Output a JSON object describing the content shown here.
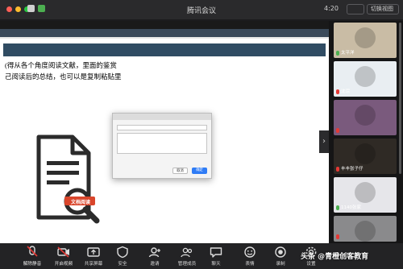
{
  "app": {
    "title": "腾讯会议",
    "time": "4:20",
    "btn_left": "",
    "btn_right": "切换视图"
  },
  "slide": {
    "heading": "(得从各个角度阅读文献，里面的鉴赏",
    "subtitle": "己阅读后的总结，也可以是复制粘贴里",
    "icon_badge": "文档阅读"
  },
  "dialog": {
    "title": "",
    "prompt": "",
    "url": "",
    "cancel": "取消",
    "ok": "确定"
  },
  "doc_lines": [
    "",
    "",
    "",
    "",
    "",
    "",
    "",
    "",
    "",
    "",
    "",
    "",
    "",
    "",
    "",
    "",
    "",
    "",
    "",
    "",
    "",
    "",
    "",
    "",
    "",
    "",
    "",
    "",
    "",
    "",
    "",
    "",
    ""
  ],
  "participants": [
    {
      "name": "太平洋",
      "color": "#c9bca5",
      "muted": false
    },
    {
      "name": "沈淙",
      "color": "#e9eef2",
      "muted": true
    },
    {
      "name": "",
      "color": "#7a5a7d",
      "muted": true
    },
    {
      "name": "丰丰张子仔",
      "color": "#2f2a25",
      "muted": true
    },
    {
      "name": "1140张家",
      "color": "#e6e6ea",
      "muted": false
    },
    {
      "name": "",
      "color": "#8a8a8c",
      "muted": true
    }
  ],
  "toolbar": [
    {
      "label": "解除静音",
      "icon": "mic-muted-icon",
      "red": true
    },
    {
      "label": "开启视频",
      "icon": "video-off-icon",
      "red": true
    },
    {
      "label": "共享屏幕",
      "icon": "share-screen-icon",
      "red": false
    },
    {
      "label": "安全",
      "icon": "shield-icon",
      "red": false
    },
    {
      "label": "邀请",
      "icon": "invite-icon",
      "red": false
    },
    {
      "label": "管理成员",
      "icon": "members-icon",
      "red": false
    },
    {
      "label": "聊天",
      "icon": "chat-icon",
      "red": false
    },
    {
      "label": "表情",
      "icon": "reaction-icon",
      "red": false
    },
    {
      "label": "录制",
      "icon": "record-icon",
      "red": false
    },
    {
      "label": "设置",
      "icon": "gear-icon",
      "red": false
    }
  ],
  "watermark": "头条 @青橙创客教育",
  "colors": {
    "accent_blue": "#2f7cf6",
    "mute_red": "#e53935",
    "slide_band": "#304c63",
    "panel_bg": "#151516"
  }
}
